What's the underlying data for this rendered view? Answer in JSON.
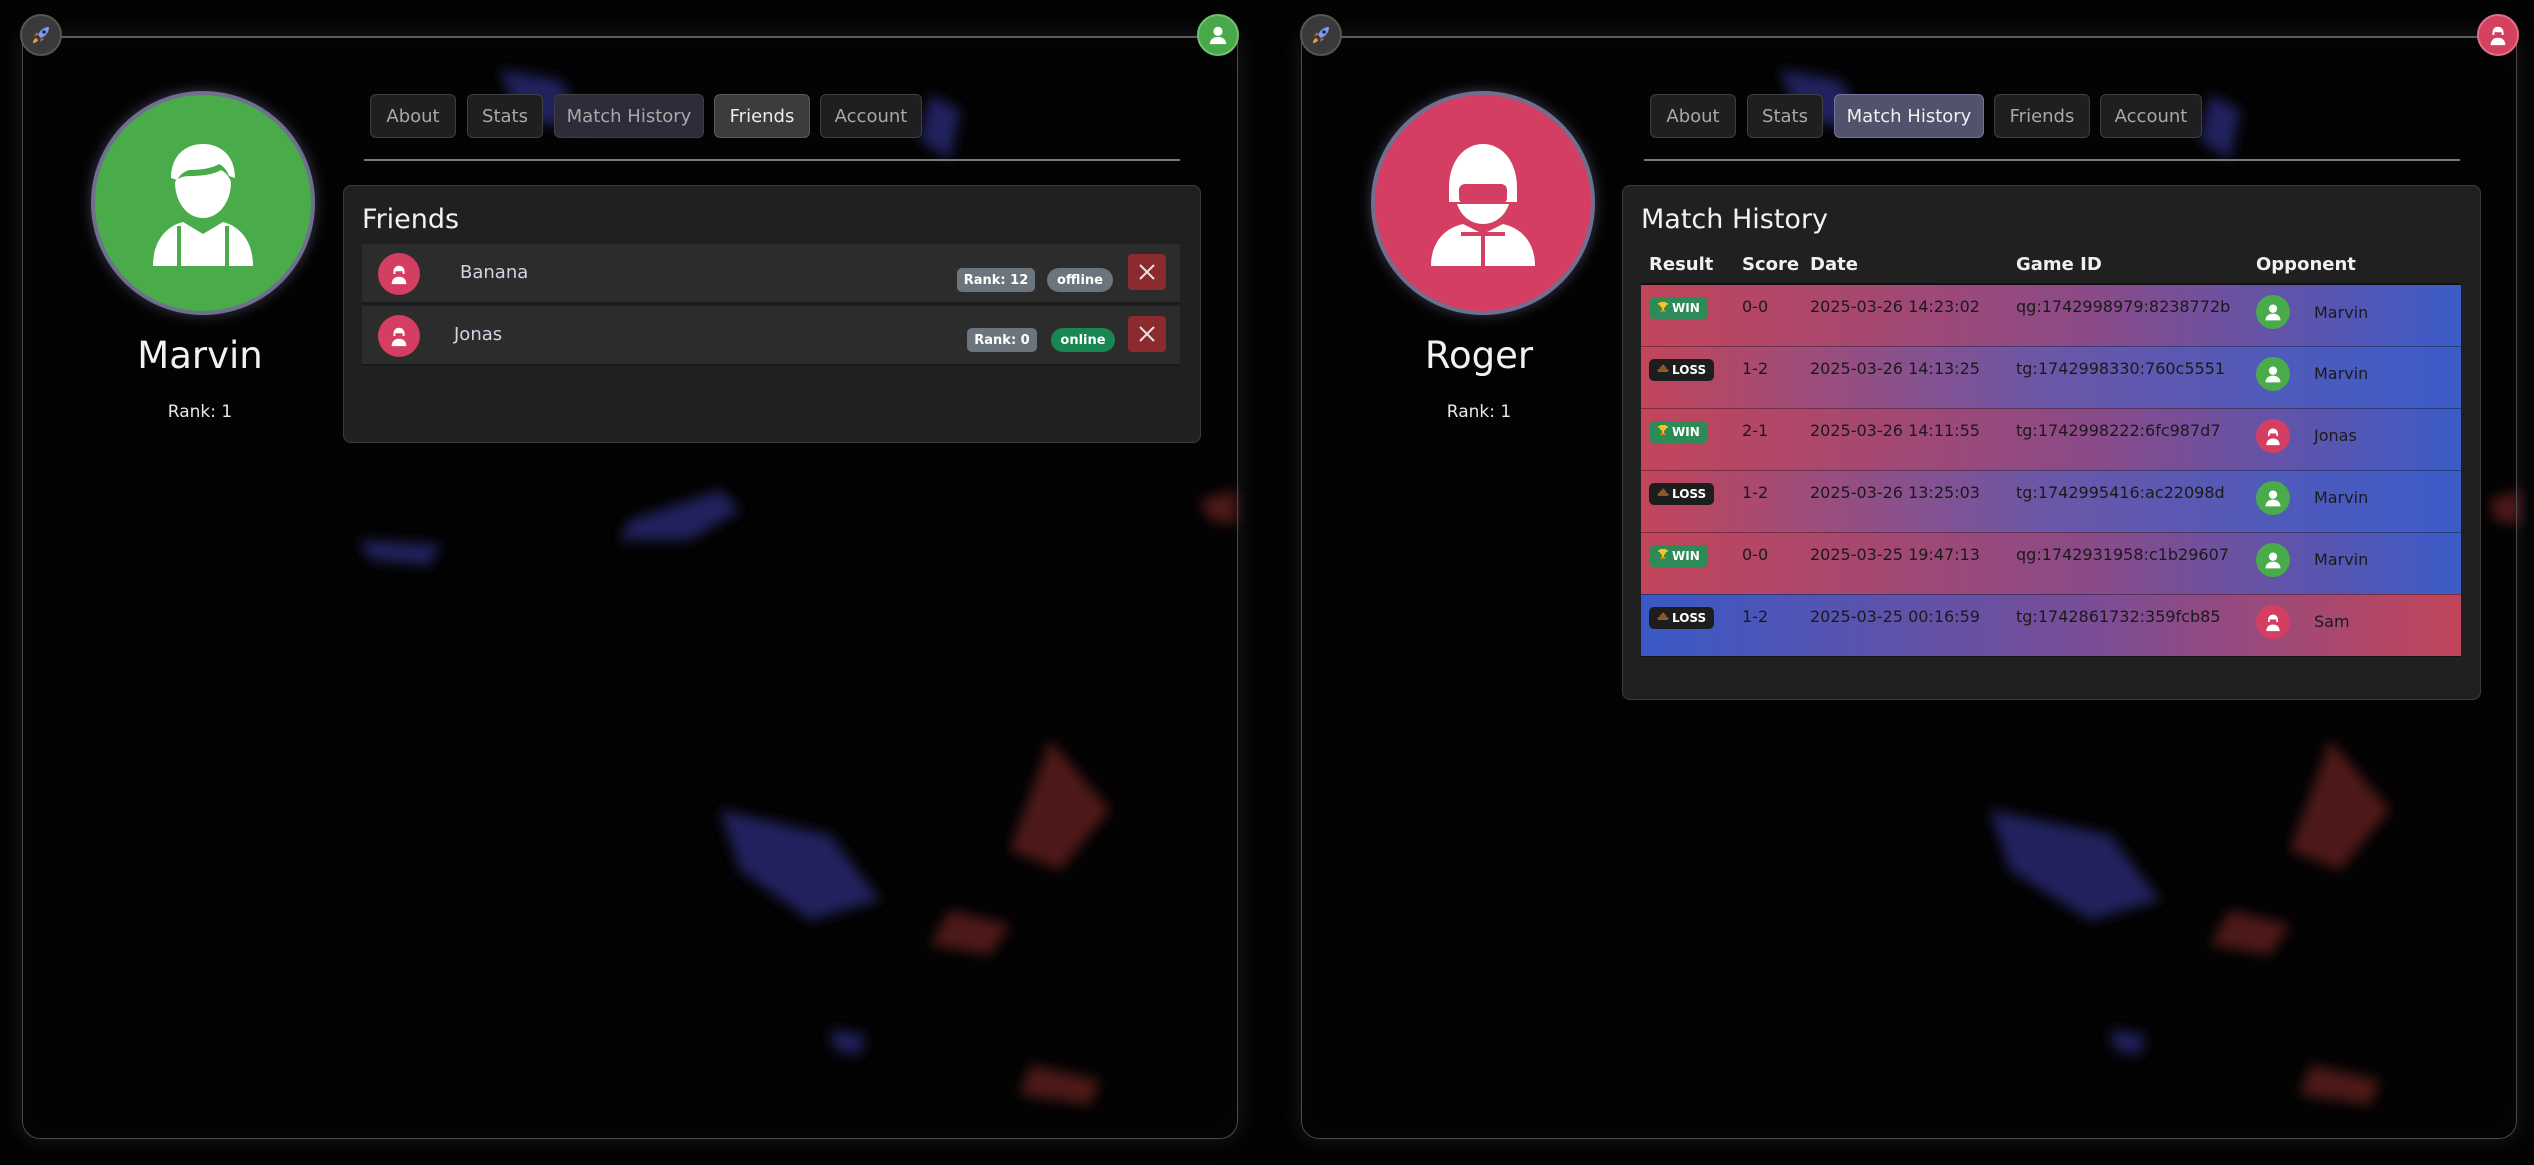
{
  "colors": {
    "green_user": "#4aab4a",
    "red_user": "#d33e62",
    "win_badge": "#2e8b57",
    "loss_badge": "#1d1d1d",
    "online": "#198754",
    "offline": "#6c757d",
    "remove": "#8b2a2f"
  },
  "left": {
    "user": {
      "name": "Marvin",
      "rank": "Rank: 1",
      "avatar_icon": "person-icon",
      "color": "green"
    },
    "tabs": [
      {
        "label": "About"
      },
      {
        "label": "Stats"
      },
      {
        "label": "Match History"
      },
      {
        "label": "Friends"
      },
      {
        "label": "Account"
      }
    ],
    "active_tab": "Friends",
    "friends": {
      "title": "Friends",
      "items": [
        {
          "name": "Banana",
          "rank": "Rank: 12",
          "status": "offline"
        },
        {
          "name": "Jonas",
          "rank": "Rank: 0",
          "status": "online"
        }
      ]
    }
  },
  "right": {
    "user": {
      "name": "Roger",
      "rank": "Rank: 1",
      "avatar_icon": "helmet-person-icon",
      "color": "red"
    },
    "tabs": [
      {
        "label": "About"
      },
      {
        "label": "Stats"
      },
      {
        "label": "Match History"
      },
      {
        "label": "Friends"
      },
      {
        "label": "Account"
      }
    ],
    "active_tab": "Match History",
    "match_history": {
      "title": "Match History",
      "columns": [
        "Result",
        "Score",
        "Date",
        "Game ID",
        "Opponent"
      ],
      "rows": [
        {
          "result": "WIN",
          "result_icon": "trophy-icon",
          "score": "0-0",
          "date": "2025-03-26 14:23:02",
          "game_id": "qg:1742998979:8238772b",
          "opponent": "Marvin",
          "opponent_color": "green"
        },
        {
          "result": "LOSS",
          "result_icon": "poop-icon",
          "score": "1-2",
          "date": "2025-03-26 14:13:25",
          "game_id": "tg:1742998330:760c5551",
          "opponent": "Marvin",
          "opponent_color": "green"
        },
        {
          "result": "WIN",
          "result_icon": "trophy-icon",
          "score": "2-1",
          "date": "2025-03-26 14:11:55",
          "game_id": "tg:1742998222:6fc987d7",
          "opponent": "Jonas",
          "opponent_color": "red"
        },
        {
          "result": "LOSS",
          "result_icon": "poop-icon",
          "score": "1-2",
          "date": "2025-03-26 13:25:03",
          "game_id": "tg:1742995416:ac22098d",
          "opponent": "Marvin",
          "opponent_color": "green"
        },
        {
          "result": "WIN",
          "result_icon": "trophy-icon",
          "score": "0-0",
          "date": "2025-03-25 19:47:13",
          "game_id": "qg:1742931958:c1b29607",
          "opponent": "Marvin",
          "opponent_color": "green"
        },
        {
          "result": "LOSS",
          "result_icon": "poop-icon",
          "score": "1-2",
          "date": "2025-03-25 00:16:59",
          "game_id": "tg:1742861732:359fcb85",
          "opponent": "Sam",
          "opponent_color": "red"
        }
      ]
    }
  }
}
